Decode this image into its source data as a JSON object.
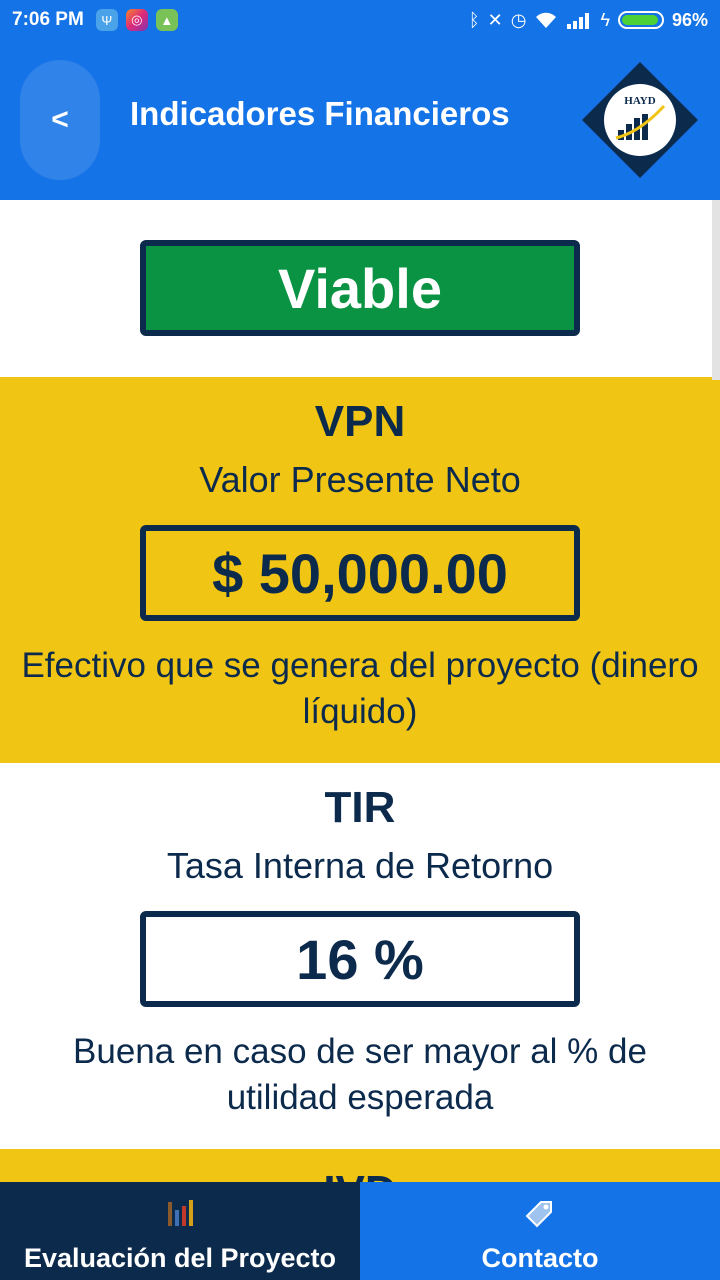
{
  "status_bar": {
    "time": "7:06 PM",
    "battery_percent": "96%",
    "battery_level": 0.96,
    "icons": [
      "usb-icon",
      "instagram-icon",
      "android-icon",
      "bluetooth-icon",
      "mute-icon",
      "alarm-icon",
      "wifi-icon",
      "signal-icon",
      "charging-icon",
      "battery-icon"
    ]
  },
  "header": {
    "back_label": "<",
    "title": "Indicadores Financieros",
    "logo_text": "HAYD"
  },
  "status": {
    "label": "Viable",
    "color": "#0A9343"
  },
  "indicators": [
    {
      "abbr": "VPN",
      "name": "Valor Presente Neto",
      "value": "$ 50,000.00",
      "description": "Efectivo que se genera del proyecto (dinero líquido)",
      "background": "#F0C514"
    },
    {
      "abbr": "TIR",
      "name": "Tasa Interna de Retorno",
      "value": "16 %",
      "description": "Buena en caso de ser mayor al % de utilidad esperada",
      "background": "#FFFFFF"
    },
    {
      "abbr": "IVD",
      "background": "#F0C514"
    }
  ],
  "bottom_nav": {
    "items": [
      {
        "label": "Evaluación del Proyecto",
        "icon": "bar-chart-icon"
      },
      {
        "label": "Contacto",
        "icon": "tag-icon"
      }
    ]
  },
  "colors": {
    "primary_blue": "#1473E6",
    "navy": "#0C2A4C",
    "yellow": "#F0C514",
    "green": "#0A9343"
  }
}
